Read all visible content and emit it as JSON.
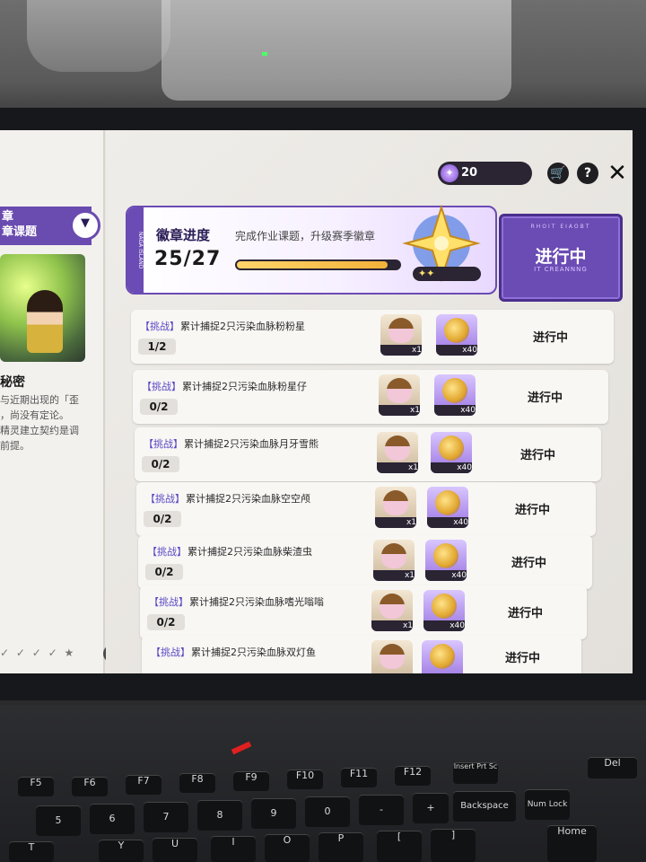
{
  "topbar": {
    "currency_amount": "20",
    "currency_icon": "star-coin-icon"
  },
  "left_panel": {
    "chapter_line1": "章",
    "chapter_line2": "章课题",
    "title": "秘密",
    "desc_lines": [
      "与近期出现的「歪",
      "，尚没有定论。",
      "精灵建立契约是调",
      "前提。"
    ]
  },
  "banner": {
    "title": "徽章进度",
    "subtitle": "完成作业课题，升级赛季徽章",
    "progress_text": "25/27",
    "progress_value": 25,
    "progress_max": 27,
    "vertical_text": "NAGA ISLAND"
  },
  "status_card": {
    "label": "进行中",
    "sub": "IT CREANNNG",
    "top": "RHOIT EIAOBT"
  },
  "tasks": [
    {
      "tag": "【挑战】",
      "name": "累计捕捉2只污染血脉粉粉星",
      "progress": "1/2",
      "r1_qty": "x1",
      "r2_qty": "x40",
      "state": "进行中"
    },
    {
      "tag": "【挑战】",
      "name": "累计捕捉2只污染血脉粉星仔",
      "progress": "0/2",
      "r1_qty": "x1",
      "r2_qty": "x40",
      "state": "进行中"
    },
    {
      "tag": "【挑战】",
      "name": "累计捕捉2只污染血脉月牙雪熊",
      "progress": "0/2",
      "r1_qty": "x1",
      "r2_qty": "x40",
      "state": "进行中"
    },
    {
      "tag": "【挑战】",
      "name": "累计捕捉2只污染血脉空空颅",
      "progress": "0/2",
      "r1_qty": "x1",
      "r2_qty": "x40",
      "state": "进行中"
    },
    {
      "tag": "【挑战】",
      "name": "累计捕捉2只污染血脉柴渣虫",
      "progress": "0/2",
      "r1_qty": "x1",
      "r2_qty": "x40",
      "state": "进行中"
    },
    {
      "tag": "【挑战】",
      "name": "累计捕捉2只污染血脉嗜光嗡嗡",
      "progress": "0/2",
      "r1_qty": "x1",
      "r2_qty": "x40",
      "state": "进行中"
    },
    {
      "tag": "【挑战】",
      "name": "累计捕捉2只污染血脉双灯鱼",
      "progress": "",
      "r1_qty": "",
      "r2_qty": "",
      "state": "进行中"
    }
  ],
  "keyboard": {
    "fn_keys": [
      "F5",
      "F6",
      "F7",
      "F8",
      "F9",
      "F10",
      "F11",
      "F12",
      "Insert Prt Sc",
      "Del"
    ],
    "num_row": [
      "5",
      "6",
      "7",
      "8",
      "9",
      "0",
      "-",
      "+",
      "Backspace",
      "Num Lock"
    ],
    "letter_row": [
      "T",
      "Y",
      "U",
      "I",
      "O",
      "P",
      "[",
      "]",
      "Home"
    ]
  }
}
